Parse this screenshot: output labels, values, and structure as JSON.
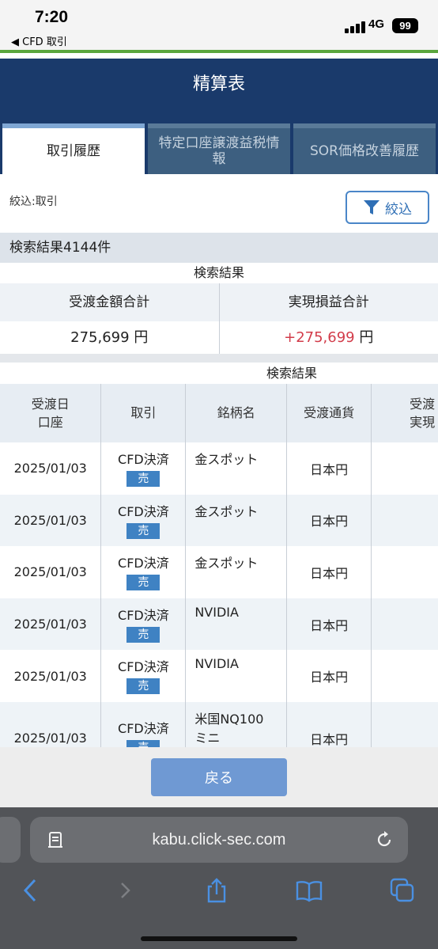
{
  "status": {
    "time": "7:20",
    "back_app": "◀ CFD 取引",
    "network": "4G",
    "battery": "99"
  },
  "header": {
    "title": "精算表"
  },
  "tabs": [
    {
      "label": "取引履歴"
    },
    {
      "label": "特定口座譲渡益税情報"
    },
    {
      "label": "SOR価格改善履歴"
    }
  ],
  "filter": {
    "label": "絞込:取引",
    "button_label": "絞込"
  },
  "result_count": "検索結果4144件",
  "summary": {
    "caption": "検索結果",
    "col1_header": "受渡金額合計",
    "col2_header": "実現損益合計",
    "col1_value": "275,699",
    "col1_unit": "円",
    "col2_value": "+275,699",
    "col2_unit": "円",
    "positive_color": "#d23c4a"
  },
  "results": {
    "caption": "検索結果",
    "headers": {
      "date": "受渡日",
      "account": "口座",
      "trade": "取引",
      "name": "銘柄名",
      "currency": "受渡通貨",
      "extra1": "受渡",
      "extra2": "実現"
    },
    "rows": [
      {
        "date": "2025/01/03",
        "trade": "CFD決済",
        "side": "売",
        "name": "金スポット",
        "name2": "",
        "currency": "日本円"
      },
      {
        "date": "2025/01/03",
        "trade": "CFD決済",
        "side": "売",
        "name": "金スポット",
        "name2": "",
        "currency": "日本円"
      },
      {
        "date": "2025/01/03",
        "trade": "CFD決済",
        "side": "売",
        "name": "金スポット",
        "name2": "",
        "currency": "日本円"
      },
      {
        "date": "2025/01/03",
        "trade": "CFD決済",
        "side": "売",
        "name": "NVIDIA",
        "name2": "",
        "currency": "日本円"
      },
      {
        "date": "2025/01/03",
        "trade": "CFD決済",
        "side": "売",
        "name": "NVIDIA",
        "name2": "",
        "currency": "日本円"
      },
      {
        "date": "2025/01/03",
        "trade": "CFD決済",
        "side": "売",
        "name": "米国NQ100",
        "name2": "ミニ",
        "currency": "日本円"
      }
    ]
  },
  "back_button": "戻る",
  "browser": {
    "url": "kabu.click-sec.com"
  },
  "icons": [
    "filter-icon",
    "reader-icon",
    "reload-icon",
    "back-arrow-icon",
    "forward-arrow-icon",
    "share-icon",
    "bookmarks-icon",
    "tabs-icon"
  ]
}
